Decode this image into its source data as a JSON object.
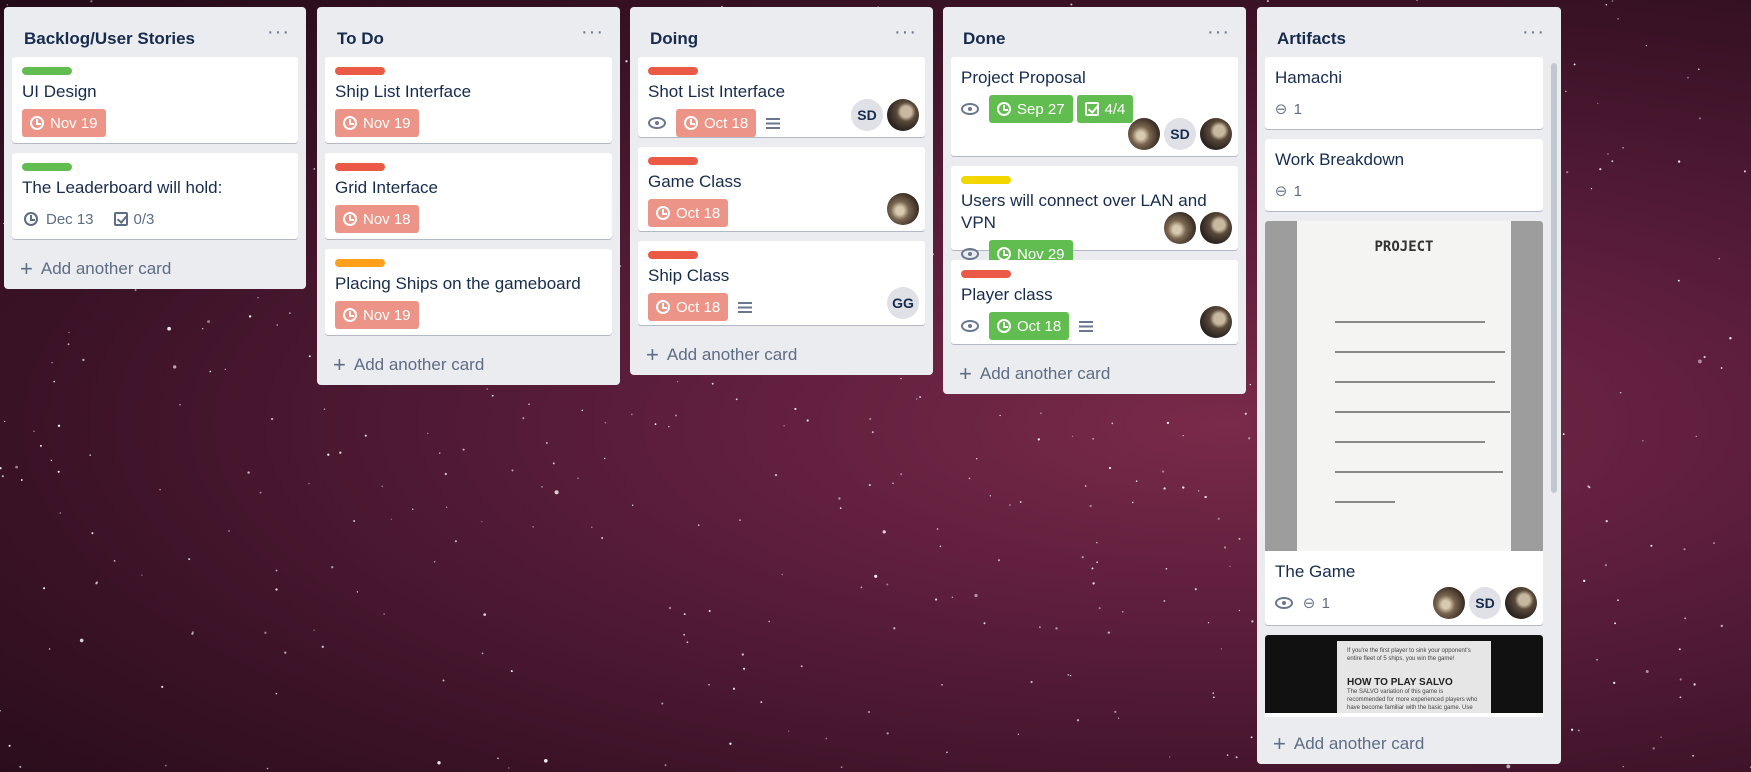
{
  "lists": [
    {
      "title": "Backlog/User Stories",
      "menu": "···",
      "add_card": "Add another card",
      "cards": [
        {
          "label": "#61bd4f",
          "title": "UI Design",
          "due": "Nov 19",
          "due_style": "red"
        },
        {
          "label": "#61bd4f",
          "title": "The Leaderboard will hold:",
          "due": "Dec 13",
          "due_style": "plain",
          "checklist": "0/3"
        }
      ]
    },
    {
      "title": "To Do",
      "menu": "···",
      "add_card": "Add another card",
      "cards": [
        {
          "label": "#eb5a46",
          "title": "Ship List Interface",
          "due": "Nov 19",
          "due_style": "red"
        },
        {
          "label": "#eb5a46",
          "title": "Grid Interface",
          "due": "Nov 18",
          "due_style": "red"
        },
        {
          "label": "#ff9f1a",
          "title": "Placing Ships on the gameboard",
          "due": "Nov 19",
          "due_style": "red"
        }
      ]
    },
    {
      "title": "Doing",
      "menu": "···",
      "add_card": "Add another card",
      "cards": [
        {
          "label": "#eb5a46",
          "title": "Shot List Interface",
          "due": "Oct 18",
          "due_style": "red",
          "watch": true,
          "description": true,
          "members": [
            "SD",
            "photo"
          ]
        },
        {
          "label": "#eb5a46",
          "title": "Game Class",
          "due": "Oct 18",
          "due_style": "red",
          "members": [
            "photo"
          ]
        },
        {
          "label": "#eb5a46",
          "title": "Ship Class",
          "due": "Oct 18",
          "due_style": "red",
          "description": true,
          "members": [
            "GG"
          ]
        }
      ]
    },
    {
      "title": "Done",
      "menu": "···",
      "add_card": "Add another card",
      "cards": [
        {
          "title": "Project Proposal",
          "due": "Sep 27",
          "due_style": "green",
          "watch": true,
          "checklist_done": "4/4",
          "members": [
            "photo2",
            "SD",
            "photo"
          ]
        },
        {
          "label": "#f2d600",
          "title": "Users will connect over LAN and VPN",
          "due": "Nov 29",
          "due_style": "green",
          "watch": true,
          "members": [
            "photo2",
            "photo"
          ]
        },
        {
          "label": "#eb5a46",
          "title": "Player class",
          "due": "Oct 18",
          "due_style": "green",
          "watch": true,
          "description": true,
          "members": [
            "photo"
          ]
        }
      ]
    },
    {
      "title": "Artifacts",
      "menu": "···",
      "add_card": "Add another card",
      "cards": [
        {
          "title": "Hamachi",
          "attachments": "1"
        },
        {
          "title": "Work Breakdown",
          "attachments": "1"
        },
        {
          "title": "The Game",
          "attachments": "1",
          "watch": true,
          "cover": "PROJECT",
          "members": [
            "photo2",
            "SD",
            "photo"
          ]
        },
        {
          "cover_dark_heading": "HOW TO PLAY SALVO",
          "cover_dark_text": "If you're the first player to sink your opponent's entire fleet of 5 ships, you win the game!",
          "cover_dark_body": "The SALVO variation of this game is recommended for more experienced players who have become familiar with the basic game. Use the same rules as in the basic game of Battleship except"
        }
      ]
    }
  ]
}
